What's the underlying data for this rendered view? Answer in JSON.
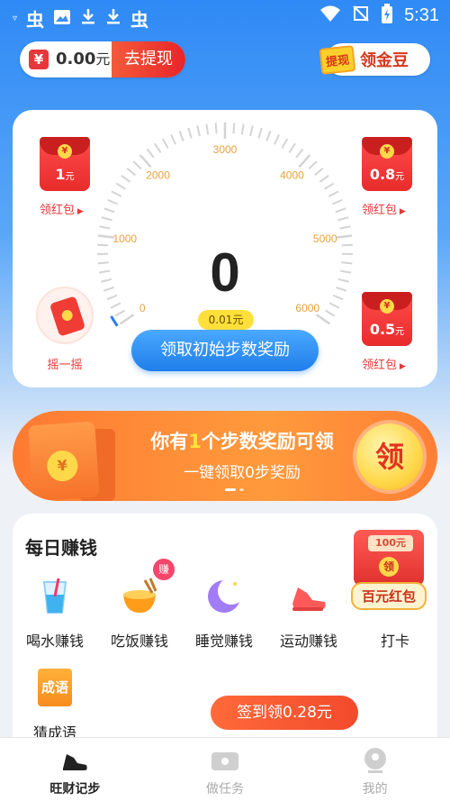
{
  "status_bar": {
    "time": "5:31"
  },
  "header": {
    "balance_amount": "0.00",
    "balance_unit": "元",
    "withdraw_label": "去提现",
    "gold_badge": "提现",
    "gold_label": "领金豆"
  },
  "gauge": {
    "tick_labels": [
      "0",
      "1000",
      "2000",
      "3000",
      "4000",
      "5000",
      "6000"
    ],
    "step_count": "0",
    "bubble_text": "0.01元",
    "claim_label": "领取初始步数奖励",
    "steps_value": 0,
    "max_value": 6000
  },
  "red_packets": {
    "left_top": {
      "amount": "1",
      "unit": "元",
      "label": "领红包"
    },
    "right_top": {
      "amount": "0.8",
      "unit": "元",
      "label": "领红包"
    },
    "right_bottom": {
      "amount": "0.5",
      "unit": "元",
      "label": "领红包"
    },
    "shake_label": "摇一摇"
  },
  "banner": {
    "title_pre": "你有",
    "title_num": "1",
    "title_post": "个步数奖励可领",
    "subtitle": "一键领取0步奖励",
    "button": "领"
  },
  "daily": {
    "title": "每日赚钱",
    "tasks": [
      {
        "label": "喝水赚钱"
      },
      {
        "label": "吃饭赚钱",
        "badge": "赚"
      },
      {
        "label": "睡觉赚钱"
      },
      {
        "label": "运动赚钱"
      },
      {
        "label": "打卡"
      },
      {
        "label": "猜成语",
        "icon_text": "成语"
      }
    ],
    "bonus": {
      "tag": "100元",
      "seal": "领",
      "label": "百元红包"
    },
    "signin_label": "签到领0.28元"
  },
  "nav": {
    "items": [
      {
        "label": "旺财记步"
      },
      {
        "label": "做任务"
      },
      {
        "label": "我的"
      }
    ]
  },
  "colors": {
    "primary_blue": "#2f8af5",
    "accent_red": "#e8373a",
    "accent_orange": "#ff7a32"
  }
}
